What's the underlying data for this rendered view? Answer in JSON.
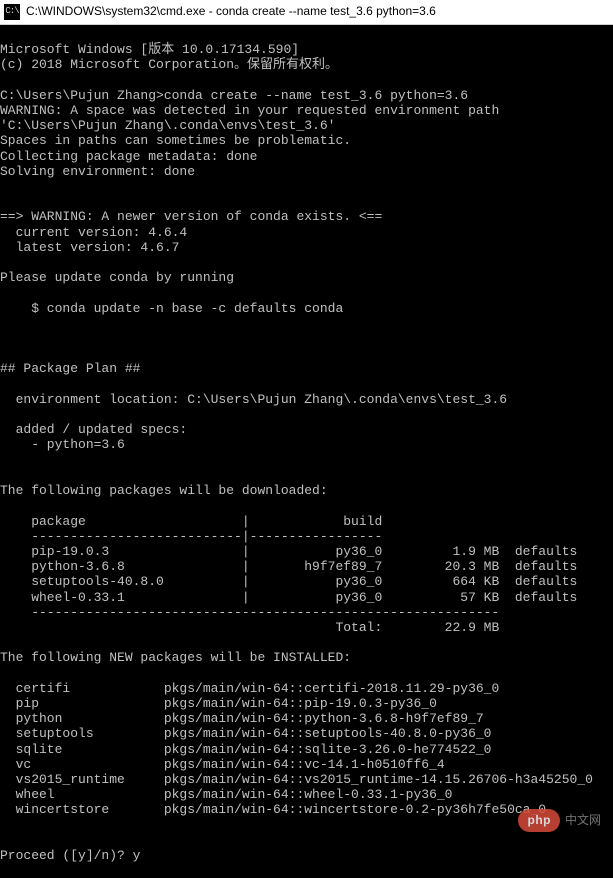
{
  "title": {
    "icon_label": "C:\\",
    "text": "C:\\WINDOWS\\system32\\cmd.exe - conda  create --name test_3.6 python=3.6"
  },
  "lines": {
    "l01": "Microsoft Windows [版本 10.0.17134.590]",
    "l02": "(c) 2018 Microsoft Corporation。保留所有权利。",
    "l03": "",
    "l04": "C:\\Users\\Pujun Zhang>conda create --name test_3.6 python=3.6",
    "l05": "WARNING: A space was detected in your requested environment path",
    "l06": "'C:\\Users\\Pujun Zhang\\.conda\\envs\\test_3.6'",
    "l07": "Spaces in paths can sometimes be problematic.",
    "l08": "Collecting package metadata: done",
    "l09": "Solving environment: done",
    "l10": "",
    "l11": "",
    "l12": "==> WARNING: A newer version of conda exists. <==",
    "l13": "  current version: 4.6.4",
    "l14": "  latest version: 4.6.7",
    "l15": "",
    "l16": "Please update conda by running",
    "l17": "",
    "l18": "    $ conda update -n base -c defaults conda",
    "l19": "",
    "l20": "",
    "l21": "",
    "l22": "## Package Plan ##",
    "l23": "",
    "l24": "  environment location: C:\\Users\\Pujun Zhang\\.conda\\envs\\test_3.6",
    "l25": "",
    "l26": "  added / updated specs:",
    "l27": "    - python=3.6",
    "l28": "",
    "l29": "",
    "l30": "The following packages will be downloaded:",
    "l31": "",
    "l32": "    package                    |            build",
    "l33": "    ---------------------------|-----------------",
    "l34": "    pip-19.0.3                 |           py36_0         1.9 MB  defaults",
    "l35": "    python-3.6.8               |       h9f7ef89_7        20.3 MB  defaults",
    "l36": "    setuptools-40.8.0          |           py36_0         664 KB  defaults",
    "l37": "    wheel-0.33.1               |           py36_0          57 KB  defaults",
    "l38": "    ------------------------------------------------------------",
    "l39": "                                           Total:        22.9 MB",
    "l40": "",
    "l41": "The following NEW packages will be INSTALLED:",
    "l42": "",
    "l43": "  certifi            pkgs/main/win-64::certifi-2018.11.29-py36_0",
    "l44": "  pip                pkgs/main/win-64::pip-19.0.3-py36_0",
    "l45": "  python             pkgs/main/win-64::python-3.6.8-h9f7ef89_7",
    "l46": "  setuptools         pkgs/main/win-64::setuptools-40.8.0-py36_0",
    "l47": "  sqlite             pkgs/main/win-64::sqlite-3.26.0-he774522_0",
    "l48": "  vc                 pkgs/main/win-64::vc-14.1-h0510ff6_4",
    "l49": "  vs2015_runtime     pkgs/main/win-64::vs2015_runtime-14.15.26706-h3a45250_0",
    "l50": "  wheel              pkgs/main/win-64::wheel-0.33.1-py36_0",
    "l51": "  wincertstore       pkgs/main/win-64::wincertstore-0.2-py36h7fe50ca_0",
    "l52": "",
    "l53": ""
  },
  "prompt": {
    "text": "Proceed ([y]/n)? ",
    "input": "y"
  },
  "watermark": {
    "logo": "php",
    "text": "中文网"
  }
}
